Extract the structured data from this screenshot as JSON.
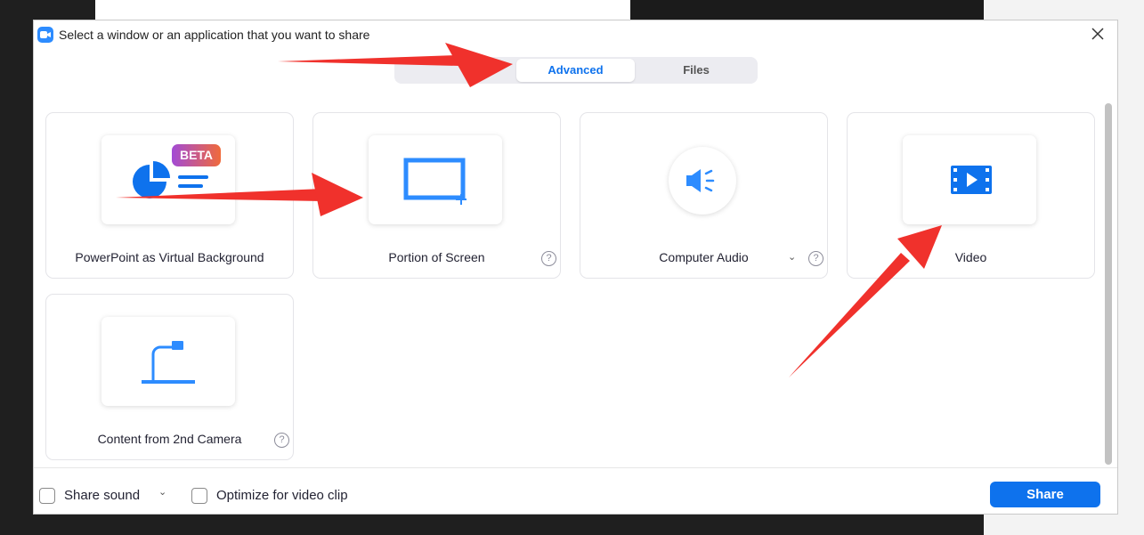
{
  "window": {
    "title": "Select a window or an application that you want to share"
  },
  "tabs": [
    {
      "label": "Advanced",
      "active": true
    },
    {
      "label": "Files",
      "active": false
    }
  ],
  "cards": [
    {
      "label": "PowerPoint as Virtual Background",
      "badge": "BETA",
      "icon": "powerpoint-pie-icon"
    },
    {
      "label": "Portion of Screen",
      "icon": "screen-portion-icon",
      "help": "?"
    },
    {
      "label": "Computer Audio",
      "icon": "speaker-icon",
      "help": "?",
      "chevron": "⌄"
    },
    {
      "label": "Video",
      "icon": "film-icon"
    },
    {
      "label": "Content from 2nd Camera",
      "icon": "document-camera-icon",
      "help": "?"
    }
  ],
  "footer": {
    "share_sound_label": "Share sound",
    "share_sound_chevron": "⌄",
    "optimize_label": "Optimize for video clip",
    "share_button": "Share"
  },
  "colors": {
    "accent": "#0e72ed",
    "icon_blue": "#2d8cff",
    "annotation_arrow": "#f0312c"
  }
}
